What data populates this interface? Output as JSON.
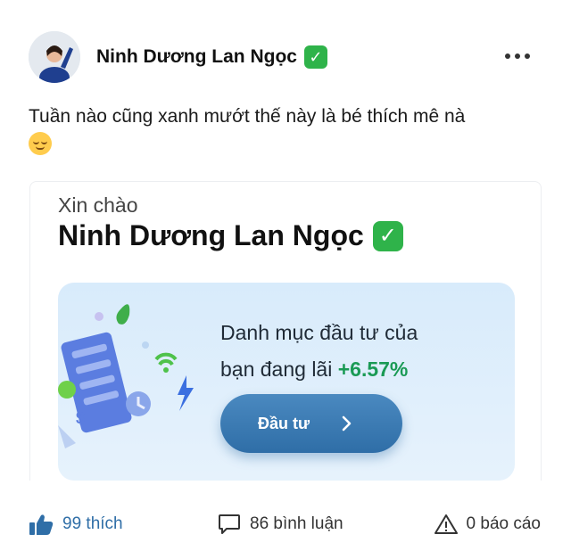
{
  "post": {
    "author": "Ninh Dương Lan Ngọc",
    "verified_badge": "✓",
    "caption": "Tuần nào cũng xanh mướt thế này là bé thích mê nà"
  },
  "card": {
    "greeting": "Xin chào",
    "name": "Ninh Dương Lan Ngọc",
    "portfolio_text_line1": "Danh mục đầu tư của",
    "portfolio_text_line2": "bạn đang lãi",
    "gain_percent": "+6.57%",
    "invest_button": "Đầu tư"
  },
  "footer": {
    "likes": "99 thích",
    "comments": "86 bình luận",
    "reports": "0 báo cáo"
  },
  "colors": {
    "accent_blue": "#2f6ea7",
    "gain_green": "#1a9a55",
    "verified_green": "#2fb34a",
    "panel_bg": "#dcecfb"
  }
}
